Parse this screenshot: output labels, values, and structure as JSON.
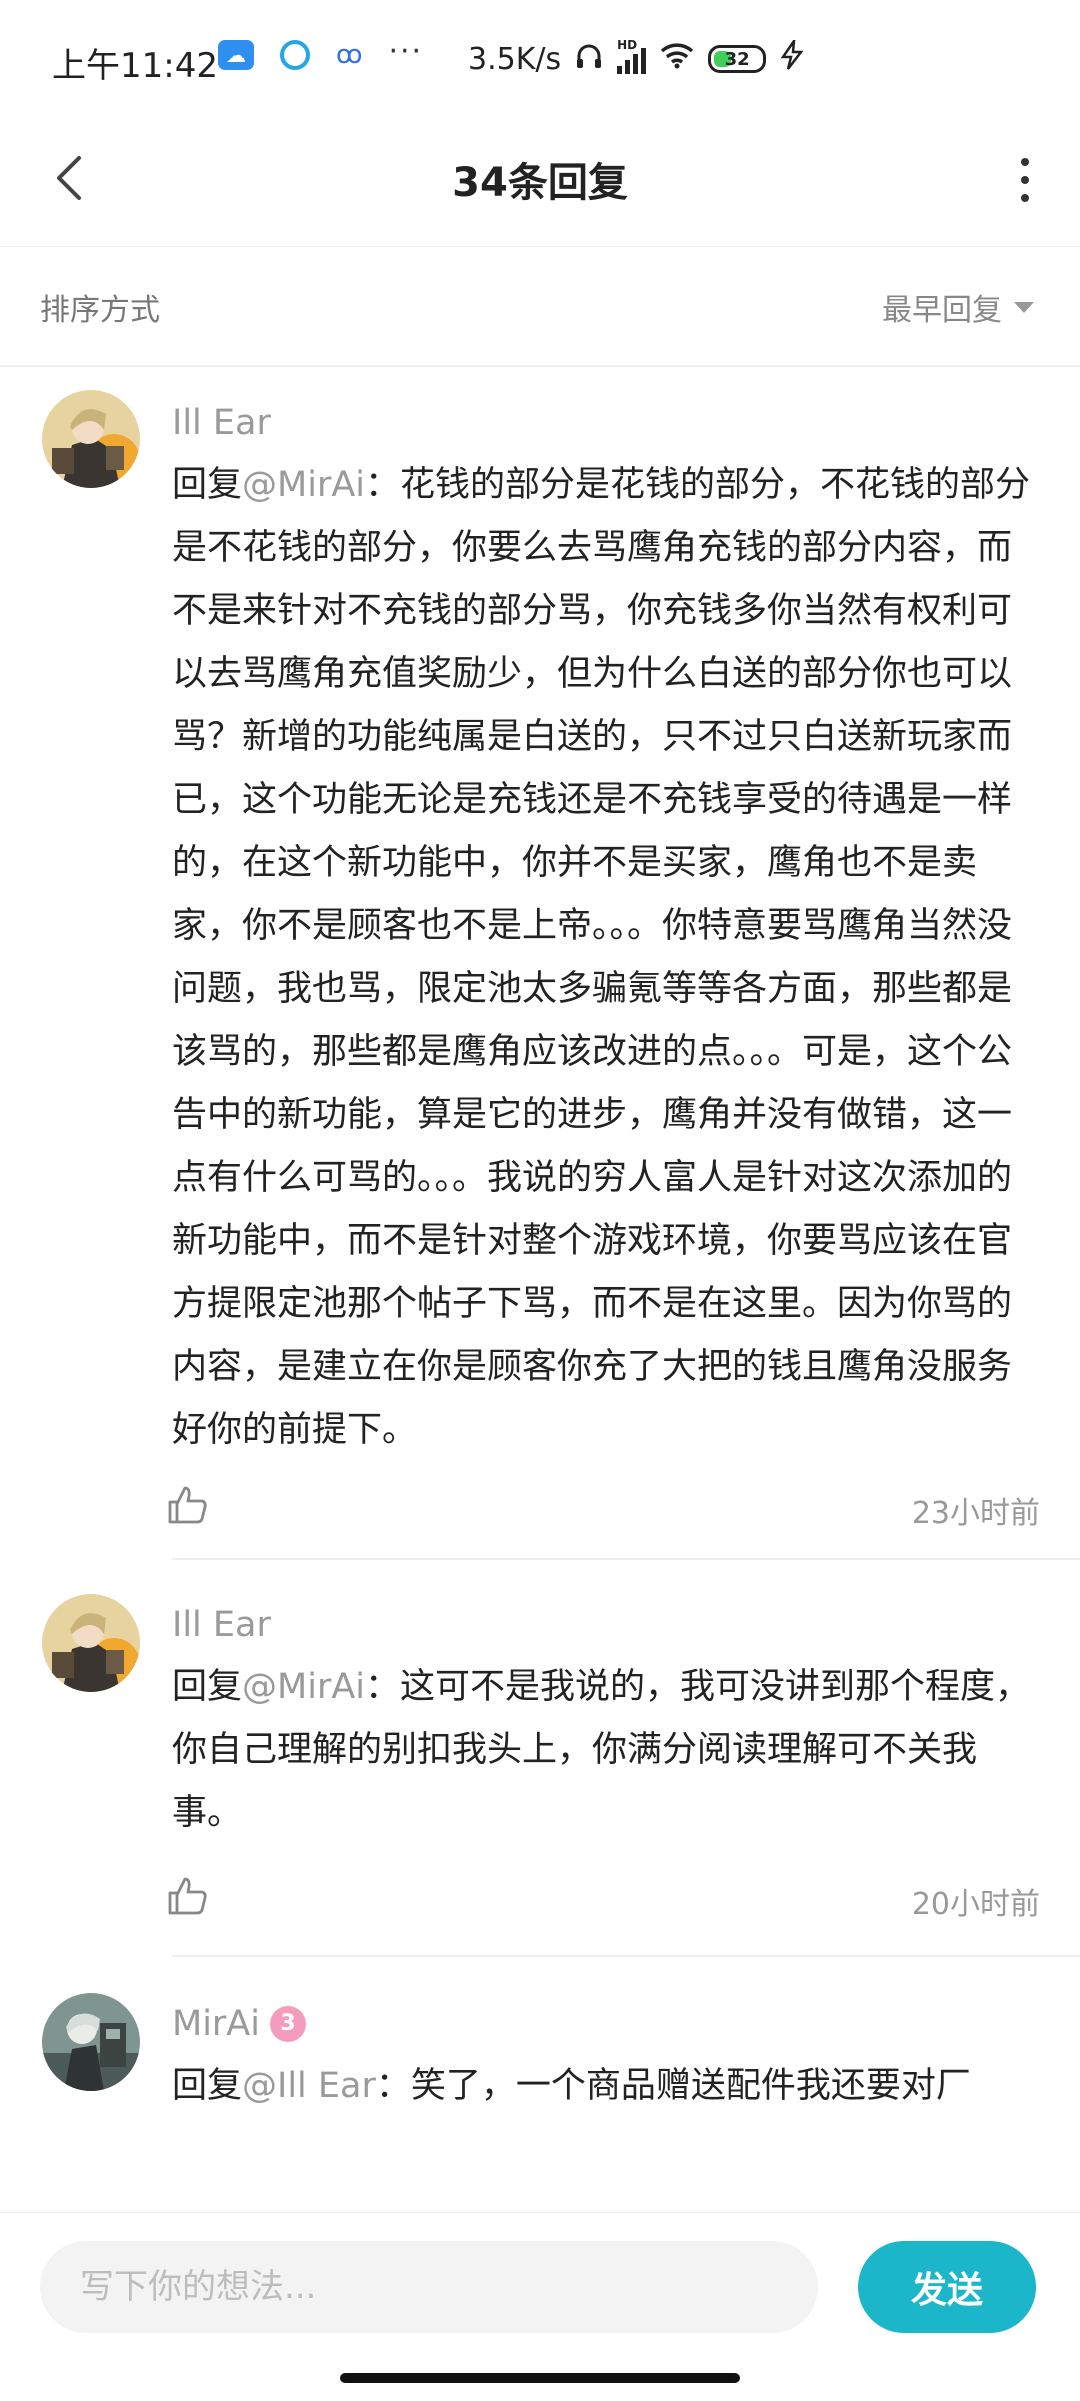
{
  "status_bar": {
    "time": "上午11:42",
    "more_dots": "···",
    "speed": "3.5K/s",
    "hd": "HD",
    "battery": "32",
    "icons": [
      "cloud-icon",
      "qq-icon",
      "baidu-icon",
      "headphones-icon",
      "signal-icon",
      "wifi-icon",
      "battery-icon",
      "charging-icon"
    ]
  },
  "header": {
    "title": "34条回复"
  },
  "sort": {
    "label": "排序方式",
    "selected": "最早回复"
  },
  "comments": [
    {
      "username": "Ill Ear",
      "reply_prefix": "回复",
      "mention": "@MirAi",
      "body": "：花钱的部分是花钱的部分，不花钱的部分是不花钱的部分，你要么去骂鹰角充钱的部分内容，而不是来针对不充钱的部分骂，你充钱多你当然有权利可以去骂鹰角充值奖励少，但为什么白送的部分你也可以骂？新增的功能纯属是白送的，只不过只白送新玩家而已，这个功能无论是充钱还是不充钱享受的待遇是一样的，在这个新功能中，你并不是买家，鹰角也不是卖家，你不是顾客也不是上帝。。。你特意要骂鹰角当然没问题，我也骂，限定池太多骗氪等等各方面，那些都是该骂的，那些都是鹰角应该改进的点。。。可是，这个公告中的新功能，算是它的进步，鹰角并没有做错，这一点有什么可骂的。。。我说的穷人富人是针对这次添加的新功能中，而不是针对整个游戏环境，你要骂应该在官方提限定池那个帖子下骂，而不是在这里。因为你骂的内容，是建立在你是顾客你充了大把的钱且鹰角没服务好你的前提下。",
      "time": "23小时前"
    },
    {
      "username": "Ill Ear",
      "reply_prefix": "回复",
      "mention": "@MirAi",
      "body": "：这可不是我说的，我可没讲到那个程度，你自己理解的别扣我头上，你满分阅读理解可不关我事。",
      "time": "20小时前"
    },
    {
      "username": "MirAi",
      "badge": "3",
      "reply_prefix": "回复",
      "mention": "@Ill Ear",
      "body": "：笑了，一个商品赠送配件我还要对厂"
    }
  ],
  "composer": {
    "placeholder": "写下你的想法...",
    "send_label": "发送"
  },
  "colors": {
    "accent": "#1bb6c9",
    "muted_text": "#9a9a9a",
    "badge": "#f39cbc"
  }
}
